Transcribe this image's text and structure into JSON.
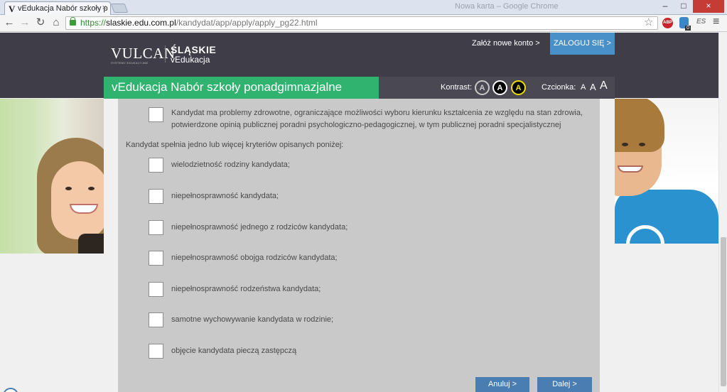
{
  "browser": {
    "tab_title": "vEdukacja Nabór szkoły p",
    "tab_favicon": "V",
    "tab_close": "×",
    "url_scheme": "https://",
    "url_host": "slaskie.edu.com.pl",
    "url_path": "/kandydat/app/apply/apply_pg22.html",
    "back_glyph": "←",
    "forward_glyph": "→",
    "reload_glyph": "↻",
    "home_glyph": "⌂",
    "star_glyph": "☆",
    "menu_glyph": "≡",
    "ext_abp": "ABP",
    "ext_badge": "0",
    "ext_es": "ES",
    "window_title": "Nowa karta – Google Chrome",
    "min_glyph": "–",
    "max_glyph": "□",
    "close_glyph": "×",
    "icons": [
      "back-icon",
      "forward-icon",
      "reload-icon",
      "home-icon",
      "lock-icon",
      "star-icon",
      "abp-icon",
      "extension-icon",
      "menu-icon"
    ]
  },
  "header": {
    "logo_vulcan": "VULCAN",
    "logo_vulcan_sub": "SYSTEMY EDUKACYJNE",
    "logo_slaskie": "ŚLĄSKIE",
    "logo_vedukacja": "vEdukacja",
    "create_account": "Załóż nowe konto >",
    "login": "ZALOGUJ SIĘ >"
  },
  "titlebar": {
    "title": "vEdukacja Nabór szkoły ponadgimnazjalne",
    "kontrast_label": "Kontrast:",
    "kontrast_options": [
      "A",
      "A",
      "A"
    ],
    "czcionka_label": "Czcionka:",
    "font_sizes": [
      "A",
      "A",
      "A"
    ]
  },
  "form": {
    "health_item": "Kandydat ma problemy zdrowotne, ograniczające możliwości wyboru kierunku kształcenia ze względu na stan zdrowia, potwierdzone opinią publicznej poradni psychologiczno-pedagogicznej, w tym publicznej poradni specjalistycznej",
    "criteria_heading": "Kandydat spełnia jedno lub więcej kryteriów opisanych poniżej:",
    "criteria": [
      "wielodzietność rodziny kandydata;",
      "niepełnosprawność kandydata;",
      "niepełnosprawność jednego z rodziców kandydata;",
      "niepełnosprawność obojga rodziców kandydata;",
      "niepełnosprawność rodzeństwa kandydata;",
      "samotne wychowywanie kandydata w rodzinie;",
      "objęcie kandydata pieczą zastępczą"
    ],
    "cancel": "Anuluj >",
    "next": "Dalej >"
  },
  "colors": {
    "header_bg": "#3f3e48",
    "green": "#2fb36f",
    "blue_button": "#4a7eb2",
    "panel_bg": "#c9c9c9"
  }
}
